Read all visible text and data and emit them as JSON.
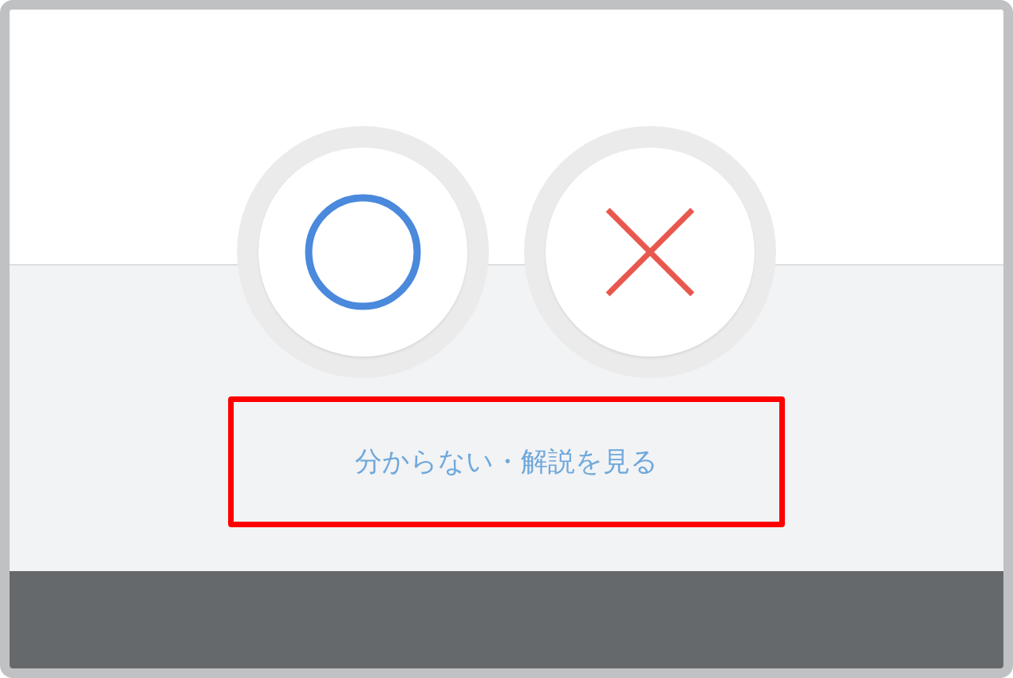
{
  "answer_buttons": [
    {
      "kind": "circle"
    },
    {
      "kind": "cross"
    }
  ],
  "explanation_link": {
    "label": "分からない・解説を見る",
    "highlighted": true
  }
}
